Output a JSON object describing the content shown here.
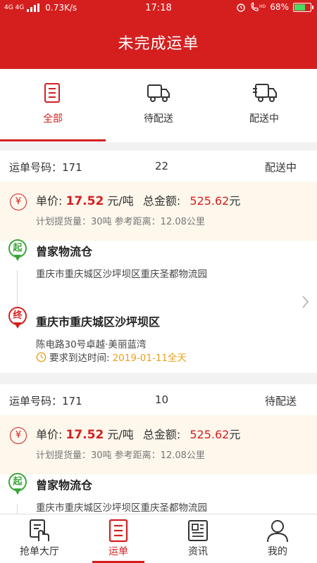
{
  "status_bar": {
    "network": "4G 4G",
    "speed": "0.73K/s",
    "time": "17:18",
    "battery": "68%",
    "battery_level": 0.68
  },
  "header": {
    "title": "未完成运单"
  },
  "tabs": [
    {
      "label": "全部",
      "icon": "list-doc-icon",
      "active": true
    },
    {
      "label": "待配送",
      "icon": "truck-icon",
      "active": false
    },
    {
      "label": "配送中",
      "icon": "fast-truck-icon",
      "active": false
    }
  ],
  "orders": [
    {
      "no_label": "运单号码：171",
      "mid": "22",
      "status": "配送中",
      "price_label": "单价:",
      "price": "17.52",
      "price_unit": "元/吨",
      "total_label": "总金额:",
      "total": "525.62",
      "total_unit": "元",
      "sub": "计划提货量：30吨    参考距离：12.08公里",
      "from_pin": "起",
      "from_name": "曾家物流仓",
      "from_addr": "重庆市重庆城区沙坪坝区重庆圣都物流园",
      "to_pin": "终",
      "to_name": "重庆市重庆城区沙坪坝区",
      "to_addr": "陈电路30号卓越·美丽蓝湾",
      "deadline_label": "要求到达时间:",
      "deadline": "2019-01-11全天"
    },
    {
      "no_label": "运单号码：171",
      "mid": "10",
      "status": "待配送",
      "price_label": "单价:",
      "price": "17.52",
      "price_unit": "元/吨",
      "total_label": "总金额:",
      "total": "525.62",
      "total_unit": "元",
      "sub": "计划提货量：30吨    参考距离：12.08公里",
      "from_pin": "起",
      "from_name": "曾家物流仓",
      "from_addr": "重庆市重庆城区沙坪坝区重庆圣都物流园"
    }
  ],
  "bottom_nav": [
    {
      "label": "抢单大厅",
      "icon": "grab-order-icon",
      "active": false
    },
    {
      "label": "运单",
      "icon": "waybill-icon",
      "active": true
    },
    {
      "label": "资讯",
      "icon": "news-icon",
      "active": false
    },
    {
      "label": "我的",
      "icon": "user-icon",
      "active": false
    }
  ],
  "colors": {
    "brand": "#d51f1f",
    "accent_date": "#e8a21a",
    "start_pin": "#3aa63a"
  }
}
